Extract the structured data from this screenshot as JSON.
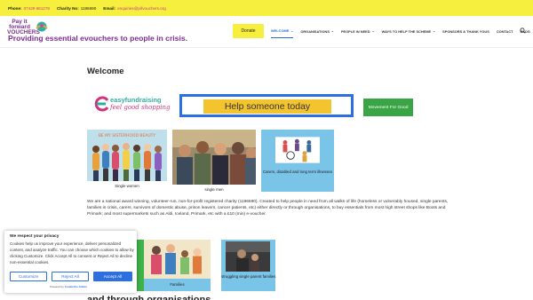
{
  "topbar": {
    "phone_label": "Phone:",
    "phone_value": "07429 681278",
    "charity_label": "Charity No:",
    "charity_value": "1196690",
    "email_label": "Email:",
    "email_value": "enquiries@pifvouchers.org"
  },
  "header": {
    "logo_line1": "Pay it",
    "logo_line2": "forward",
    "logo_line3": "VOUCHERS",
    "tagline": "Providing essential evouchers to people in crisis.",
    "donate_label": "Donate",
    "nav": [
      {
        "label": "WELCOME",
        "chevron": "⌄"
      },
      {
        "label": "ORGANISATIONS",
        "chevron": "⌄"
      },
      {
        "label": "PEOPLE IN NEED",
        "chevron": "⌄"
      },
      {
        "label": "WAYS TO HELP THE SCHEME",
        "chevron": "⌄"
      },
      {
        "label": "SPONSORS & THANK YOUS",
        "chevron": ""
      },
      {
        "label": "CONTACT",
        "chevron": ""
      },
      {
        "label": "BLOG",
        "chevron": ""
      }
    ],
    "search_icon": "search-icon"
  },
  "main": {
    "title": "Welcome",
    "easyfundraising_name": "easyfundraising",
    "easyfundraising_tagline": "feel good shopping",
    "help_banner": "Help someone today",
    "movement_button": "Movement For Good",
    "cards": [
      {
        "caption": "Single women",
        "image_text": "BE MY SISTERHOOD BEAUTY"
      },
      {
        "caption": "single men"
      },
      {
        "caption": "Carers, disabled and long term illnesses"
      }
    ],
    "paragraph": "We are a national award winning, volunteer-run, non-for-profit registered charity (1196690). Created to help people in need from all walks of life (homeless or vulnerably housed, single parents, families in crisis, carers, survivors of domestic abuse, prison leavers, cancer patients, etc) either directly or through organisations, to buy essentials from most high street shops like Boots and Primark; and  most supermarkets such as Aldi, Iceland, Primark, etc with a £10 (min) e-voucher.",
    "cards2": [
      {
        "caption": "Families"
      },
      {
        "caption": "struggling single parent families"
      }
    ],
    "subheading": "and through organisations"
  },
  "cookie": {
    "title": "We respect your privacy",
    "text": "Cookies help us improve your experience, deliver personalized content, and analyze traffic. You can choose which cookies to allow by clicking Customize. Click Accept All to consent or Reject All to decline non-essential cookies.",
    "customize": "Customize",
    "reject": "Reject All",
    "accept": "Accept All",
    "powered_prefix": "Powered by",
    "powered_brand": "CookieYes Admin"
  },
  "colors": {
    "topbar": "#f7ef3d",
    "brand_purple": "#7a2e8e",
    "accent_blue": "#2d6fe0",
    "green": "#3aa545",
    "card_blue": "#7ac4e8"
  }
}
